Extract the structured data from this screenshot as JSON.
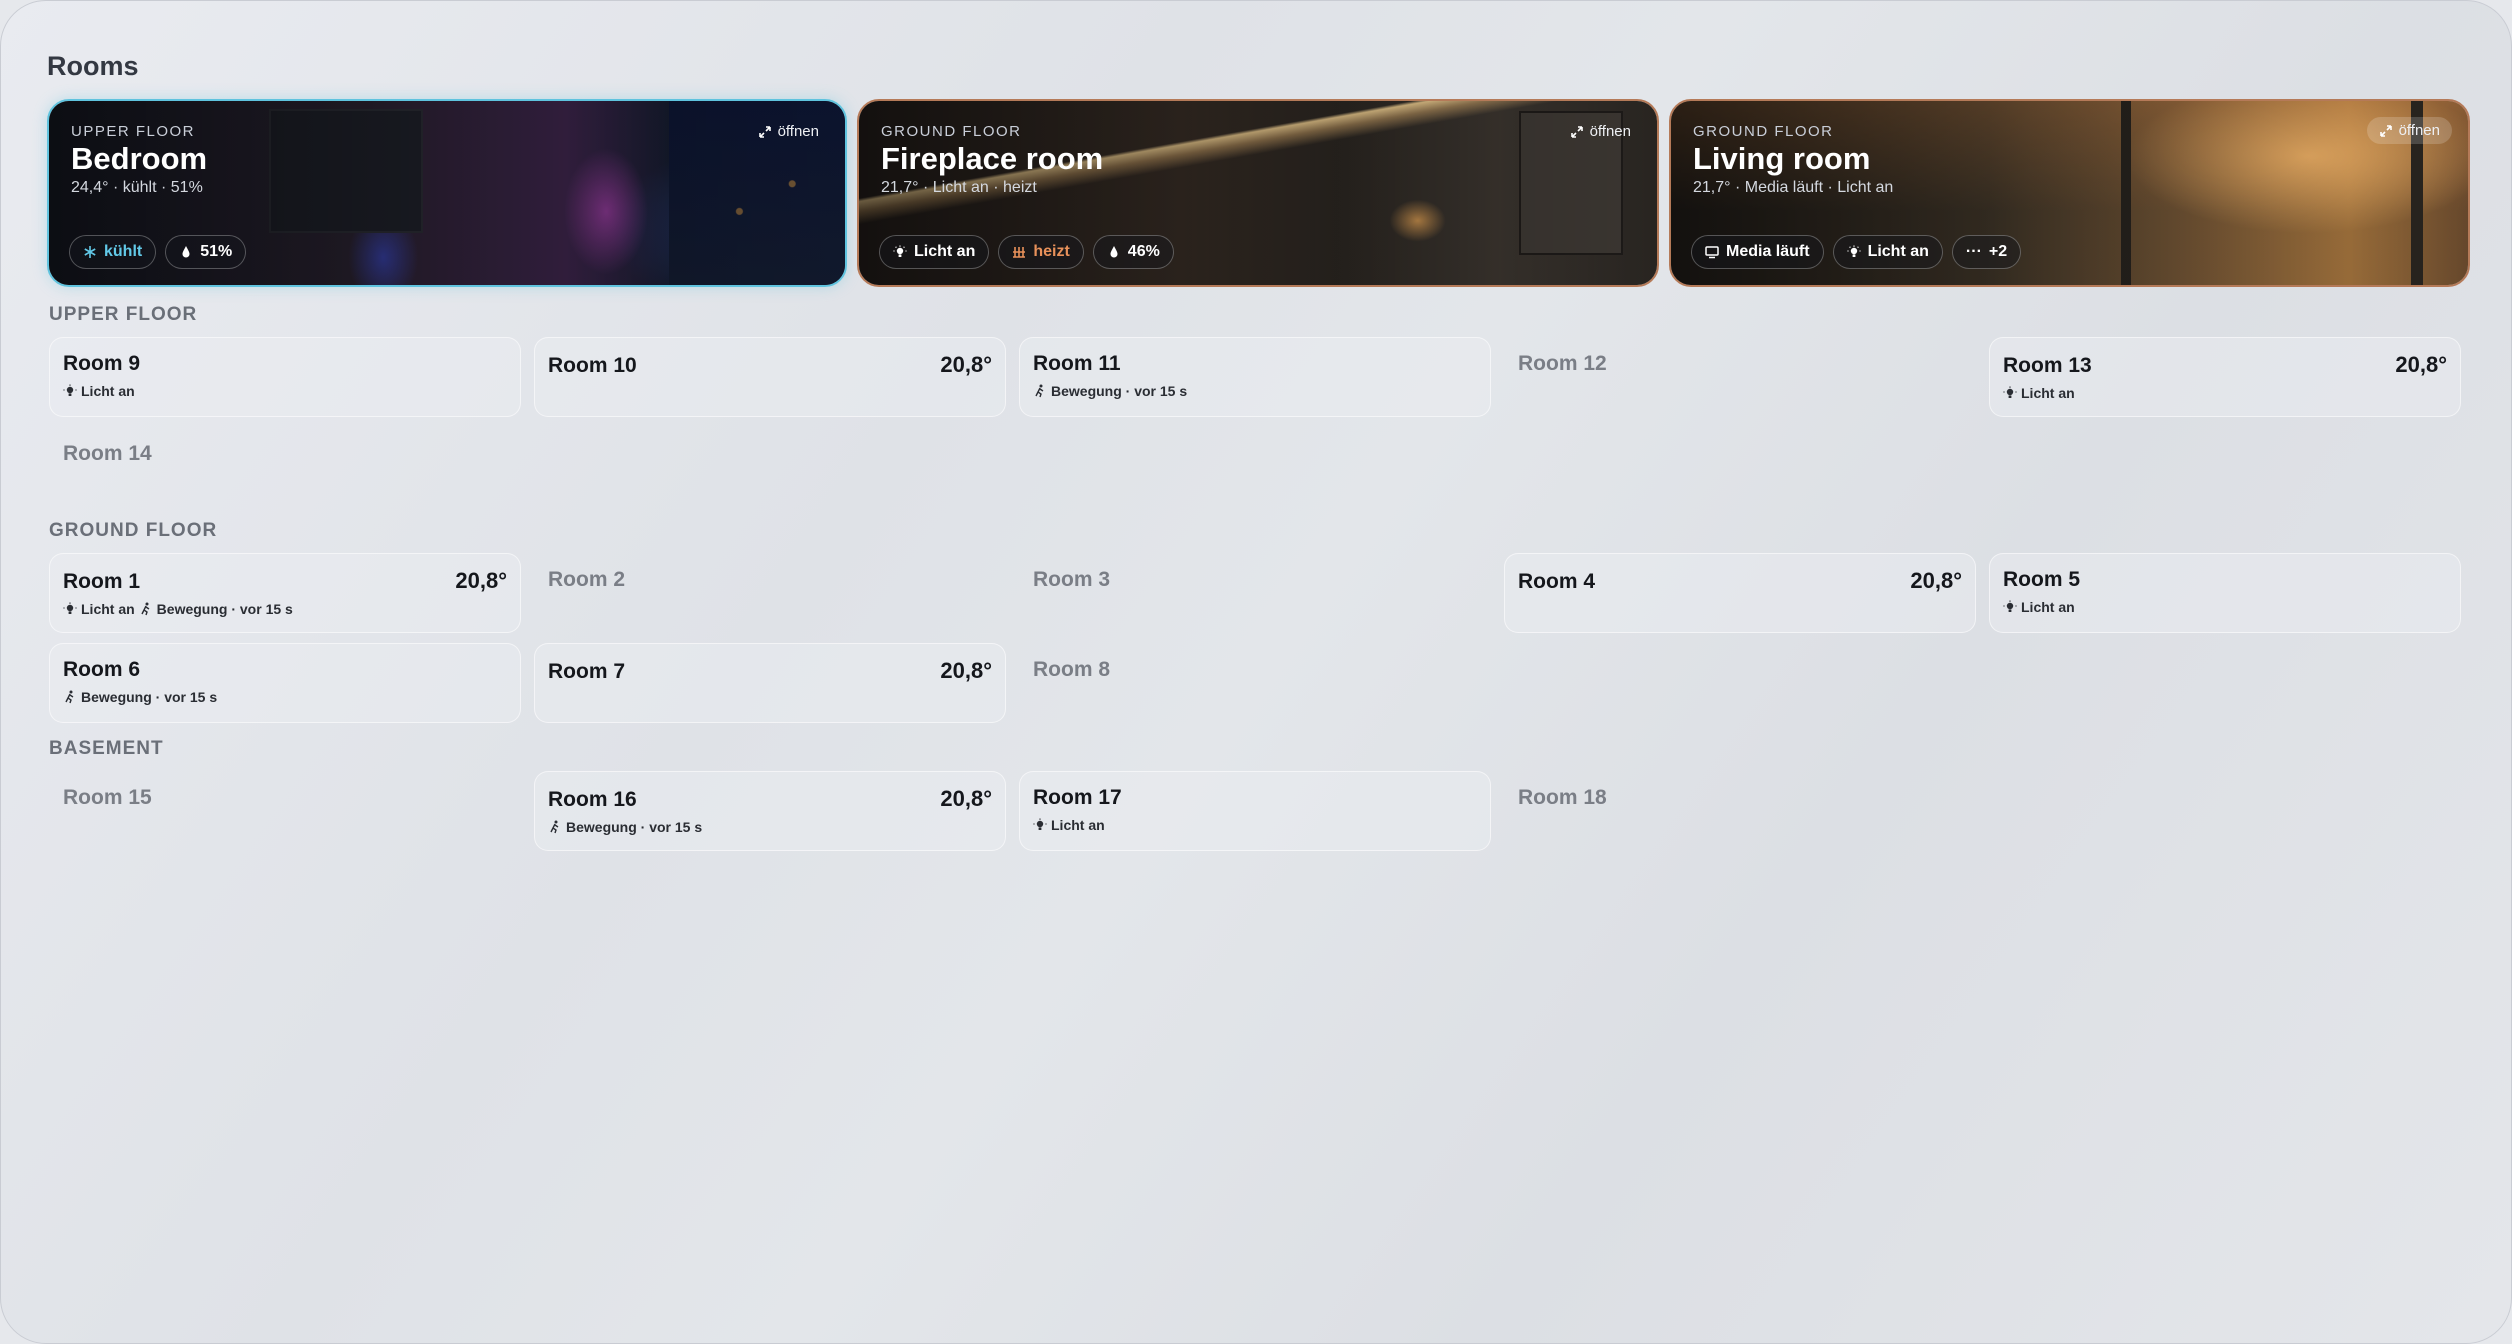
{
  "page": {
    "title": "Rooms"
  },
  "colors": {
    "cool": "#62c9e8",
    "heat": "#e8915a",
    "bedroom_border": "#5fc3de",
    "warm_border": "#c77a52"
  },
  "featured": [
    {
      "floor": "UPPER FLOOR",
      "name": "Bedroom",
      "subtitle": "24,4° · kühlt · 51%",
      "open_label": "öffnen",
      "chips": [
        {
          "icon": "snowflake-icon",
          "label": "kühlt"
        },
        {
          "icon": "droplet-icon",
          "label": "51%"
        }
      ]
    },
    {
      "floor": "GROUND FLOOR",
      "name": "Fireplace room",
      "subtitle": "21,7° · Licht an · heizt",
      "open_label": "öffnen",
      "chips": [
        {
          "icon": "lightbulb-icon",
          "label": "Licht an"
        },
        {
          "icon": "heater-icon",
          "label": "heizt"
        },
        {
          "icon": "droplet-icon",
          "label": "46%"
        }
      ]
    },
    {
      "floor": "GROUND FLOOR",
      "name": "Living room",
      "subtitle": "21,7° · Media läuft · Licht an",
      "open_label": "öffnen",
      "chips": [
        {
          "icon": "tv-icon",
          "label": "Media läuft"
        },
        {
          "icon": "lightbulb-icon",
          "label": "Licht an"
        },
        {
          "icon": "more-icon",
          "label": "+2"
        }
      ]
    }
  ],
  "sections": {
    "upper": {
      "label": "UPPER FLOOR",
      "rooms": [
        {
          "name": "Room 9",
          "status": "Licht an"
        },
        {
          "name": "Room 10",
          "temp": "20,8°"
        },
        {
          "name": "Room 11",
          "status": "Bewegung · vor 15 s"
        },
        {
          "name": "Room 12"
        },
        {
          "name": "Room 13",
          "temp": "20,8°",
          "status": "Licht an"
        },
        {
          "name": "Room 14"
        }
      ]
    },
    "ground": {
      "label": "GROUND FLOOR",
      "rooms": [
        {
          "name": "Room 1",
          "temp": "20,8°",
          "status": "Licht an",
          "status2": "Bewegung · vor 15 s"
        },
        {
          "name": "Room 2"
        },
        {
          "name": "Room 3"
        },
        {
          "name": "Room 4",
          "temp": "20,8°"
        },
        {
          "name": "Room 5",
          "status": "Licht an"
        },
        {
          "name": "Room 6",
          "status": "Bewegung · vor 15 s"
        },
        {
          "name": "Room 7",
          "temp": "20,8°"
        },
        {
          "name": "Room 8"
        }
      ]
    },
    "basement": {
      "label": "BASEMENT",
      "rooms": [
        {
          "name": "Room 15"
        },
        {
          "name": "Room 16",
          "temp": "20,8°",
          "status": "Bewegung · vor 15 s"
        },
        {
          "name": "Room 17",
          "status": "Licht an"
        },
        {
          "name": "Room 18"
        }
      ]
    }
  }
}
